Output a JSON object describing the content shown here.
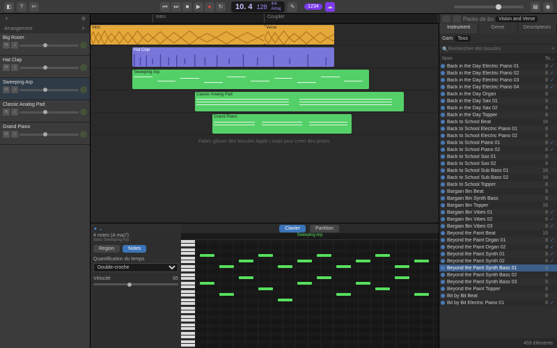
{
  "toolbar": {
    "position": "10. 4",
    "tempo": "128",
    "sig": "4/4",
    "key": "Amaj",
    "badge": "1234"
  },
  "arrangement": {
    "label": "Arrangement",
    "markers": [
      "Intro",
      "Couplet"
    ],
    "hint": "Faites glisser des boucles Apple Loops pour créer des pistes."
  },
  "tracks": [
    {
      "name": "Big Room"
    },
    {
      "name": "Hat Clap"
    },
    {
      "name": "Sweeping Arp"
    },
    {
      "name": "Classic Analog Pad"
    },
    {
      "name": "Grand Piano"
    }
  ],
  "regions": {
    "r0": "Intro",
    "r0b": "Verse",
    "r1": "Hat Clap",
    "r2": "Sweeping Arp",
    "r3": "Classic Analog Pad",
    "r4": "Grand Piano"
  },
  "editor": {
    "title": "4 notes (A maj7)",
    "subtitle": "dans Sweeping Arp",
    "tab_region": "Region",
    "tab_notes": "Notes",
    "quant_label": "Quantification du temps",
    "quant_value": "Double-croche",
    "vel_label": "Vélocité",
    "vel_value": "65",
    "view_clavier": "Clavier",
    "view_partition": "Partition",
    "region_name": "Sweeping Arp"
  },
  "browser": {
    "pack_label": "Packs de bo",
    "pack_value": "Vision and Verse",
    "tab_instr": "Instrument",
    "tab_genre": "Genre",
    "tab_desc": "Descripteurs",
    "scale_label": "Gam",
    "scale_value": "Tous",
    "search_placeholder": "Rechercher des boucles",
    "col_name": "Nom",
    "col_beats": "Te...",
    "footer": "459 éléments",
    "items": [
      {
        "n": "Back in the Day Electric Piano 01",
        "b": "8",
        "c": true
      },
      {
        "n": "Back in the Day Electric Piano 02",
        "b": "8",
        "c": true
      },
      {
        "n": "Back in the Day Electric Piano 03",
        "b": "8",
        "c": true
      },
      {
        "n": "Back in the Day Electric Piano 04",
        "b": "8",
        "c": true
      },
      {
        "n": "Back in the Day Organ",
        "b": "8"
      },
      {
        "n": "Back in the Day Sax 01",
        "b": "8"
      },
      {
        "n": "Back in the Day Sax 02",
        "b": "8"
      },
      {
        "n": "Back in the Day Topper",
        "b": "8"
      },
      {
        "n": "Back to School Beat",
        "b": "16"
      },
      {
        "n": "Back to School Electric Piano 01",
        "b": "8"
      },
      {
        "n": "Back to School Electric Piano 02",
        "b": "8"
      },
      {
        "n": "Back to School Piano 01",
        "b": "8",
        "c": true
      },
      {
        "n": "Back to School Piano 02",
        "b": "8",
        "c": true
      },
      {
        "n": "Back to School Sax 01",
        "b": "8"
      },
      {
        "n": "Back to School Sax 02",
        "b": "8"
      },
      {
        "n": "Back to School Sub Bass 01",
        "b": "16"
      },
      {
        "n": "Back to School Sub Bass 02",
        "b": "16"
      },
      {
        "n": "Back to School Topper",
        "b": "8"
      },
      {
        "n": "Bargain Bin Beat",
        "b": "8"
      },
      {
        "n": "Bargain Bin Synth Bass",
        "b": "8"
      },
      {
        "n": "Bargain Bin Topper",
        "b": "16"
      },
      {
        "n": "Bargain Bin Vibes 01",
        "b": "8",
        "c": true
      },
      {
        "n": "Bargain Bin Vibes 02",
        "b": "8",
        "c": true
      },
      {
        "n": "Bargain Bin Vibes 03",
        "b": "8",
        "c": true
      },
      {
        "n": "Beyond the Paint Beat",
        "b": "16"
      },
      {
        "n": "Beyond the Paint Organ 01",
        "b": "8",
        "c": true
      },
      {
        "n": "Beyond the Paint Organ 02",
        "b": "8",
        "c": true
      },
      {
        "n": "Beyond the Paint Synth 01",
        "b": "8",
        "c": true
      },
      {
        "n": "Beyond the Paint Synth 02",
        "b": "8",
        "c": true
      },
      {
        "n": "Beyond the Paint Synth Bass 01",
        "b": "8",
        "sel": true
      },
      {
        "n": "Beyond the Paint Synth Bass 02",
        "b": "8"
      },
      {
        "n": "Beyond the Paint Synth Bass 03",
        "b": "8"
      },
      {
        "n": "Beyond the Paint Topper",
        "b": "8"
      },
      {
        "n": "Bit by Bit Beat",
        "b": "8"
      },
      {
        "n": "Bit by Bit Electric Piano 01",
        "b": "8",
        "c": true
      }
    ]
  }
}
